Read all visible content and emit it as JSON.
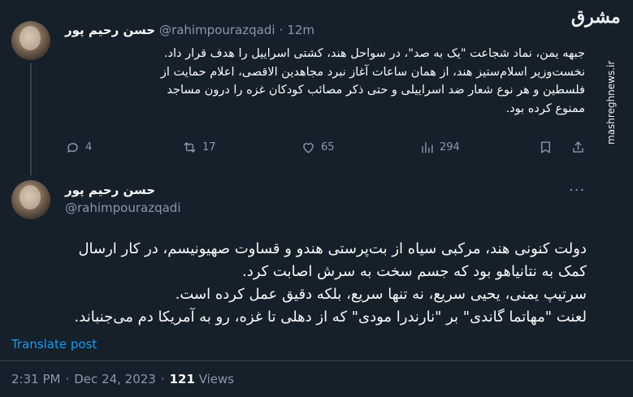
{
  "tweet1": {
    "author_name": "حسن رحیم پور",
    "handle": "@rahimpourazqadi",
    "separator": "·",
    "time_ago": "12m",
    "text": "جبهه یمن، نماد شجاعت \"یک به صد\"، در سواحل هند، کشتی اسراییل را هدف قرار داد.\nنخست‌وزیر اسلام‌ستیز هند، از همان ساعات آغاز نبرد مجاهدین الاقصی، اعلام حمایت از\nفلسطین و هر نوع شعار ضد اسراییلی و حتی ذکر مصائب کودکان غزه را درون مساجد\nممنوع کرده بود.",
    "replies": "4",
    "reposts": "17",
    "likes": "65",
    "views": "294"
  },
  "tweet2": {
    "author_name": "حسن رحیم پور",
    "handle": "@rahimpourazqadi",
    "more": "···",
    "text": "دولت کنونی هند، مرکبی سیاه از بت‌پرستی هندو و قساوت صهیونیسم، در کار ارسال\nکمک به نتانیاهو بود که جسم سخت به سرش اصابت کرد.\nسرتیپ یمنی، یحیی سریع، نه تنها سریع، بلکه دقیق عمل کرده است.\nلعنت \"مهاتما گاندی\" بر \"نارندرا مودی\" که از دهلی تا غزه، رو به آمریکا دم می‌جنباند.",
    "translate_label": "Translate post",
    "time": "2:31 PM",
    "date_separator": "·",
    "date": "Dec 24, 2023",
    "views_count": "121",
    "views_label": "Views"
  },
  "watermark": {
    "logo_text": "مشرق",
    "site": "mashreghnews.ir"
  },
  "icons": {
    "reply": "reply-icon",
    "repost": "repost-icon",
    "like": "heart-icon",
    "views": "views-icon",
    "bookmark": "bookmark-icon",
    "share": "share-icon"
  },
  "colors": {
    "background": "#15202b",
    "text": "#f7f9f9",
    "muted": "#8b98a5",
    "link": "#1d9bf0",
    "divider": "#38444d"
  }
}
